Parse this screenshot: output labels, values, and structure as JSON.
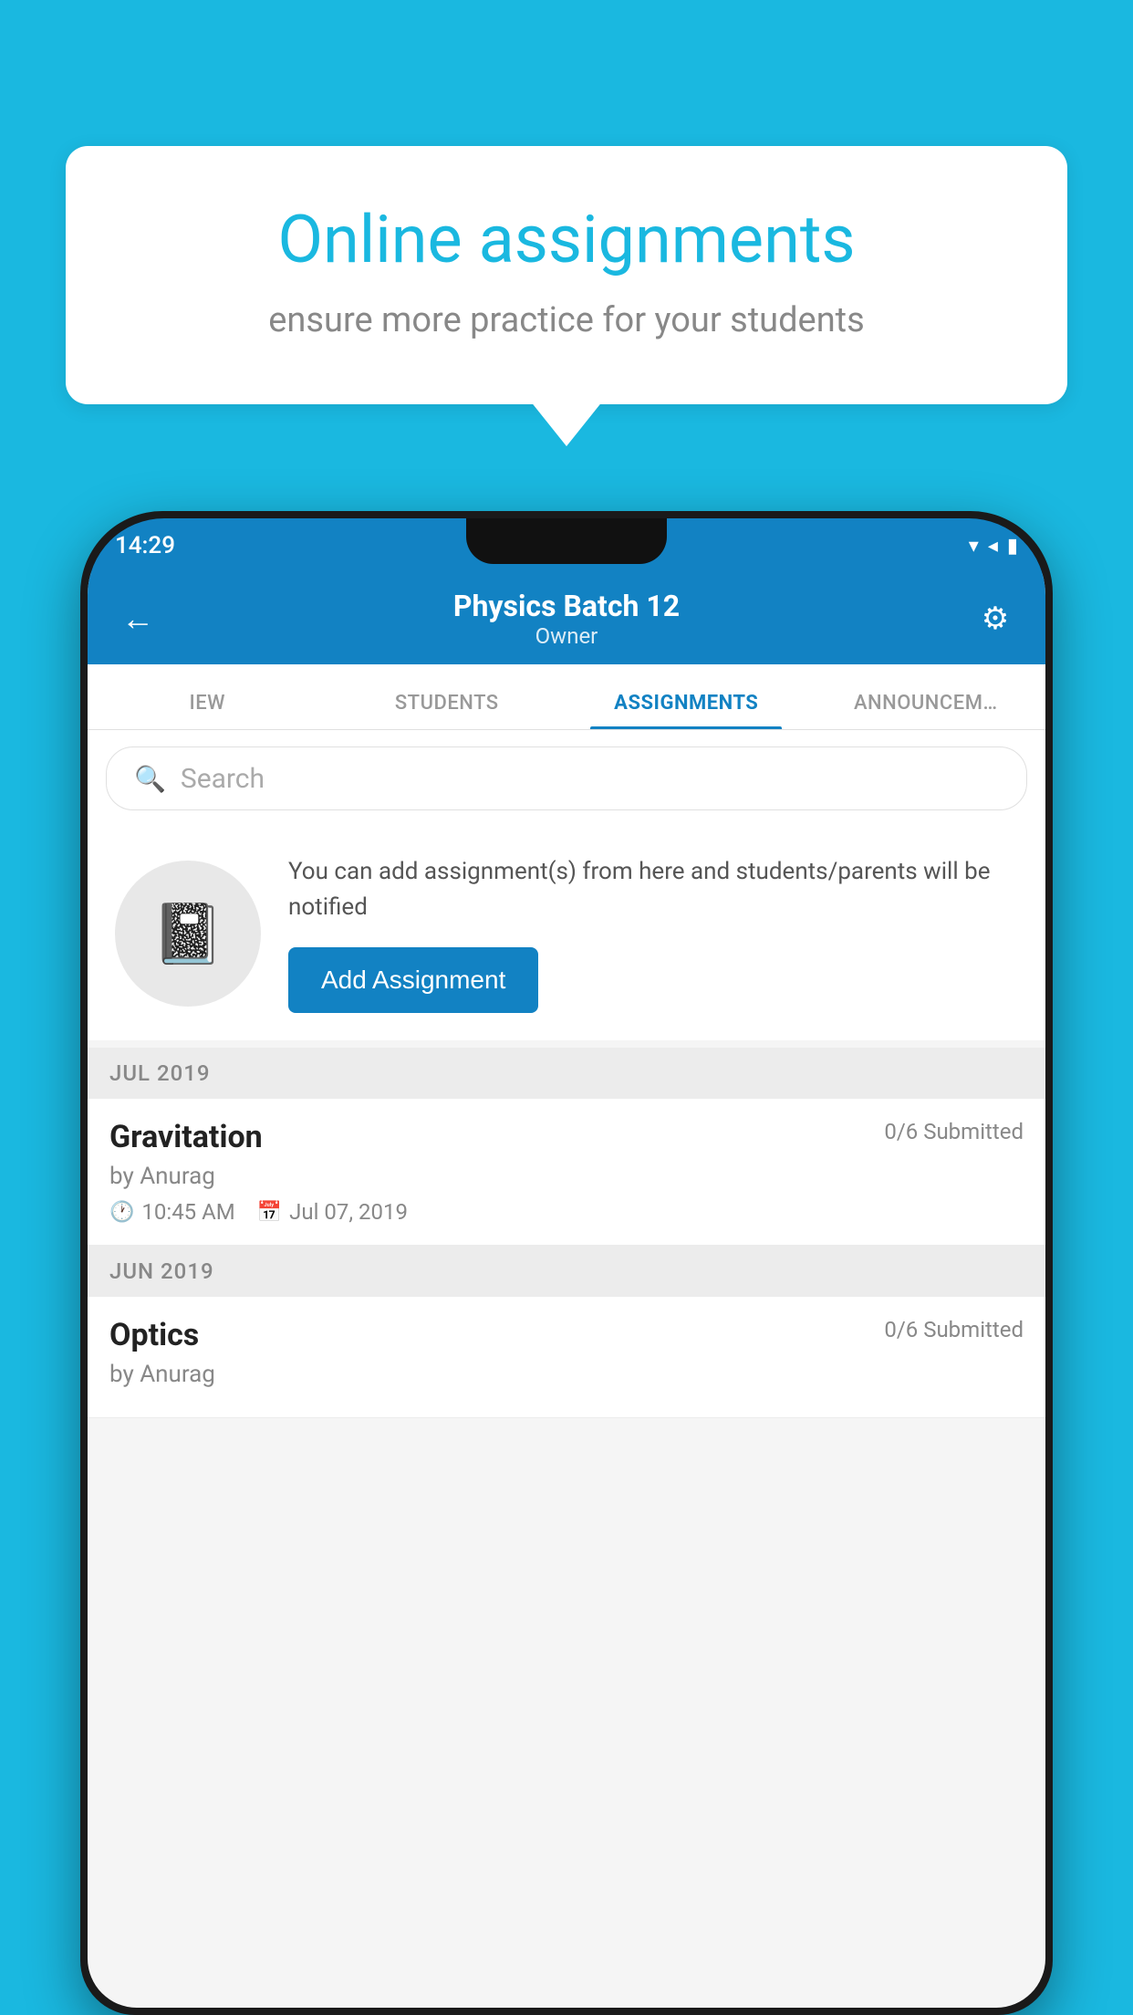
{
  "background_color": "#1ab8e0",
  "speech_bubble": {
    "title": "Online assignments",
    "subtitle": "ensure more practice for your students"
  },
  "phone": {
    "status_bar": {
      "time": "14:29",
      "icons": "▾◂▮"
    },
    "header": {
      "title": "Physics Batch 12",
      "subtitle": "Owner",
      "back_icon": "←",
      "settings_icon": "⚙"
    },
    "tabs": [
      {
        "label": "IEW",
        "active": false
      },
      {
        "label": "STUDENTS",
        "active": false
      },
      {
        "label": "ASSIGNMENTS",
        "active": true
      },
      {
        "label": "ANNOUNCEM…",
        "active": false
      }
    ],
    "search": {
      "placeholder": "Search"
    },
    "assignment_prompt": {
      "description": "You can add assignment(s) from here and students/parents will be notified",
      "button_label": "Add Assignment"
    },
    "sections": [
      {
        "month": "JUL 2019",
        "assignments": [
          {
            "name": "Gravitation",
            "submitted": "0/6 Submitted",
            "by": "by Anurag",
            "time": "10:45 AM",
            "date": "Jul 07, 2019"
          }
        ]
      },
      {
        "month": "JUN 2019",
        "assignments": [
          {
            "name": "Optics",
            "submitted": "0/6 Submitted",
            "by": "by Anurag",
            "time": "",
            "date": ""
          }
        ]
      }
    ]
  }
}
